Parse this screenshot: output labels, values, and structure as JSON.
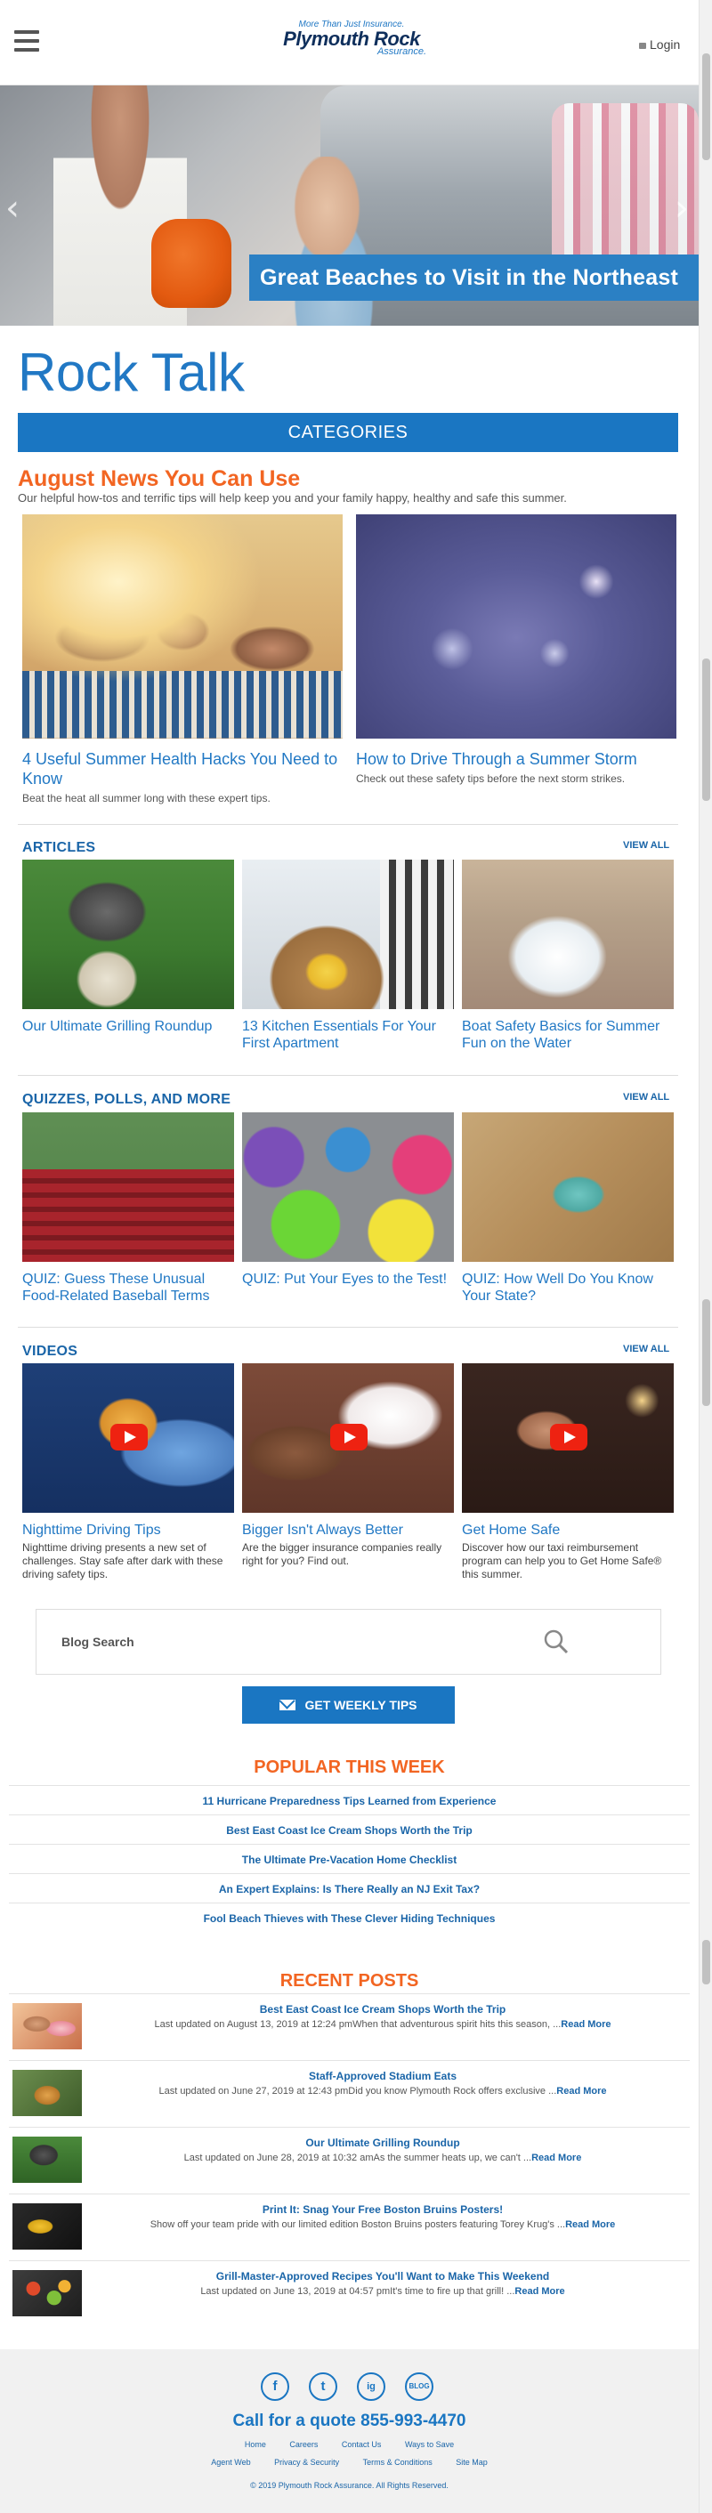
{
  "header": {
    "tagline": "More Than Just Insurance.",
    "brand": "Plymouth Rock",
    "brand_sub": "Assurance.",
    "login_label": "Login"
  },
  "hero": {
    "caption": "Great Beaches to Visit in the Northeast",
    "prev_arrow": "‹",
    "next_arrow": "›"
  },
  "page_title": "Rock Talk",
  "categories_label": "CATEGORIES",
  "august": {
    "title": "August News You Can Use",
    "subtitle": "Our helpful how-tos and terrific tips will help keep you and your family happy, healthy and safe this summer.",
    "features": [
      {
        "title": "4 Useful Summer Health Hacks You Need to Know",
        "desc": "Beat the heat all summer long with these expert tips."
      },
      {
        "title": "How to Drive Through a Summer Storm",
        "desc": "Check out these safety tips before the next storm strikes."
      }
    ]
  },
  "articles": {
    "title": "ARTICLES",
    "view_all": "VIEW ALL",
    "items": [
      {
        "title": "Our Ultimate Grilling Roundup"
      },
      {
        "title": "13 Kitchen Essentials For Your First Apartment"
      },
      {
        "title": "Boat Safety Basics for Summer Fun on the Water"
      }
    ]
  },
  "quizzes": {
    "title": "QUIZZES, POLLS, AND MORE",
    "view_all": "VIEW ALL",
    "items": [
      {
        "title": "QUIZ: Guess These Unusual Food-Related Baseball Terms"
      },
      {
        "title": "QUIZ: Put Your Eyes to the Test!"
      },
      {
        "title": "QUIZ: How Well Do You Know Your State?"
      }
    ]
  },
  "videos": {
    "title": "VIDEOS",
    "view_all": "VIEW ALL",
    "items": [
      {
        "title": "Nighttime Driving Tips",
        "desc": "Nighttime driving presents a new set of challenges. Stay safe after dark with these driving safety tips."
      },
      {
        "title": "Bigger Isn't Always Better",
        "desc": "Are the bigger insurance companies really right for you? Find out."
      },
      {
        "title": "Get Home Safe",
        "desc": "Discover how our taxi reimbursement program can help you to Get Home Safe® this summer."
      }
    ]
  },
  "search": {
    "placeholder": "Blog Search"
  },
  "weekly_button": "GET WEEKLY TIPS",
  "popular": {
    "title": "POPULAR THIS WEEK",
    "items": [
      "11 Hurricane Preparedness Tips Learned from Experience",
      "Best East Coast Ice Cream Shops Worth the Trip",
      "The Ultimate Pre-Vacation Home Checklist",
      "An Expert Explains: Is There Really an NJ Exit Tax?",
      "Fool Beach Thieves with These Clever Hiding Techniques"
    ]
  },
  "recent": {
    "title": "RECENT POSTS",
    "read_more": "Read More",
    "items": [
      {
        "title": "Best East Coast Ice Cream Shops Worth the Trip",
        "meta": "Last updated on August 13, 2019 at 12:24 pmWhen that adventurous spirit hits this season, ..."
      },
      {
        "title": "Staff-Approved Stadium Eats",
        "meta": "Last updated on June 27, 2019 at 12:43 pmDid you know Plymouth Rock offers exclusive ..."
      },
      {
        "title": "Our Ultimate Grilling Roundup",
        "meta": "Last updated on June 28, 2019 at 10:32 amAs the summer heats up, we can't ..."
      },
      {
        "title": "Print It: Snag Your Free Boston Bruins Posters!",
        "meta": "Show off your team pride with our limited edition Boston Bruins posters featuring Torey Krug's ..."
      },
      {
        "title": "Grill-Master-Approved Recipes You'll Want to Make This Weekend",
        "meta": "Last updated on June 13, 2019 at 04:57 pmIt's time to fire up that grill! ..."
      }
    ]
  },
  "footer": {
    "social": [
      "f",
      "t",
      "ig",
      "BLOG"
    ],
    "call_label": "Call for a quote",
    "phone": "855-993-4470",
    "links_row1": [
      "Home",
      "Careers",
      "Contact Us",
      "Ways to Save"
    ],
    "links_row2": [
      "Agent Web",
      "Privacy & Security",
      "Terms & Conditions",
      "Site Map"
    ],
    "copyright": "© 2019 Plymouth Rock Assurance. All Rights Reserved."
  },
  "colors": {
    "accent": "#1a76c2",
    "orange": "#f26522",
    "link": "#2178c4"
  }
}
